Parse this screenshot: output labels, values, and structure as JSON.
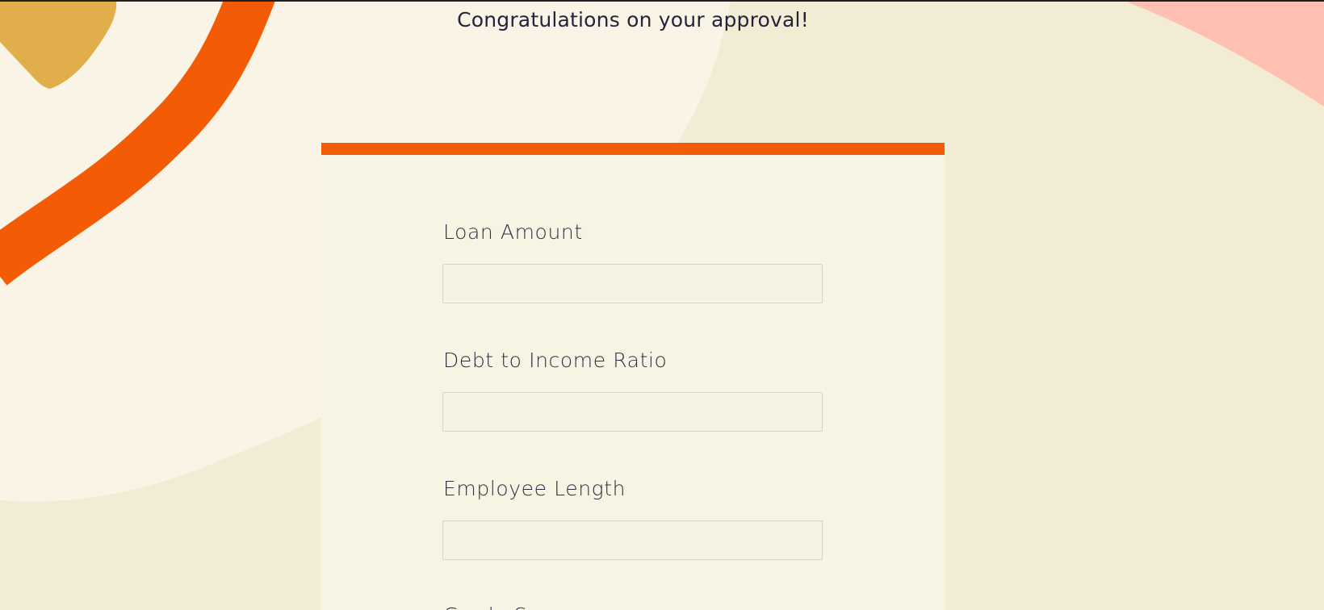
{
  "page": {
    "headline": "Congratulations on your approval!"
  },
  "form": {
    "fields": [
      {
        "label": "Loan Amount",
        "value": ""
      },
      {
        "label": "Debt to Income Ratio",
        "value": ""
      },
      {
        "label": "Employee Length",
        "value": ""
      }
    ],
    "partial_next_label": "Grade Score"
  },
  "colors": {
    "accent": "#f45b05",
    "background": "#f3ecd5",
    "blob_light": "#faf4e6",
    "blob_gold": "#e0af4c",
    "blob_pink": "#ffc0b1",
    "card": "#f8f4e4",
    "text": "#23233a"
  }
}
